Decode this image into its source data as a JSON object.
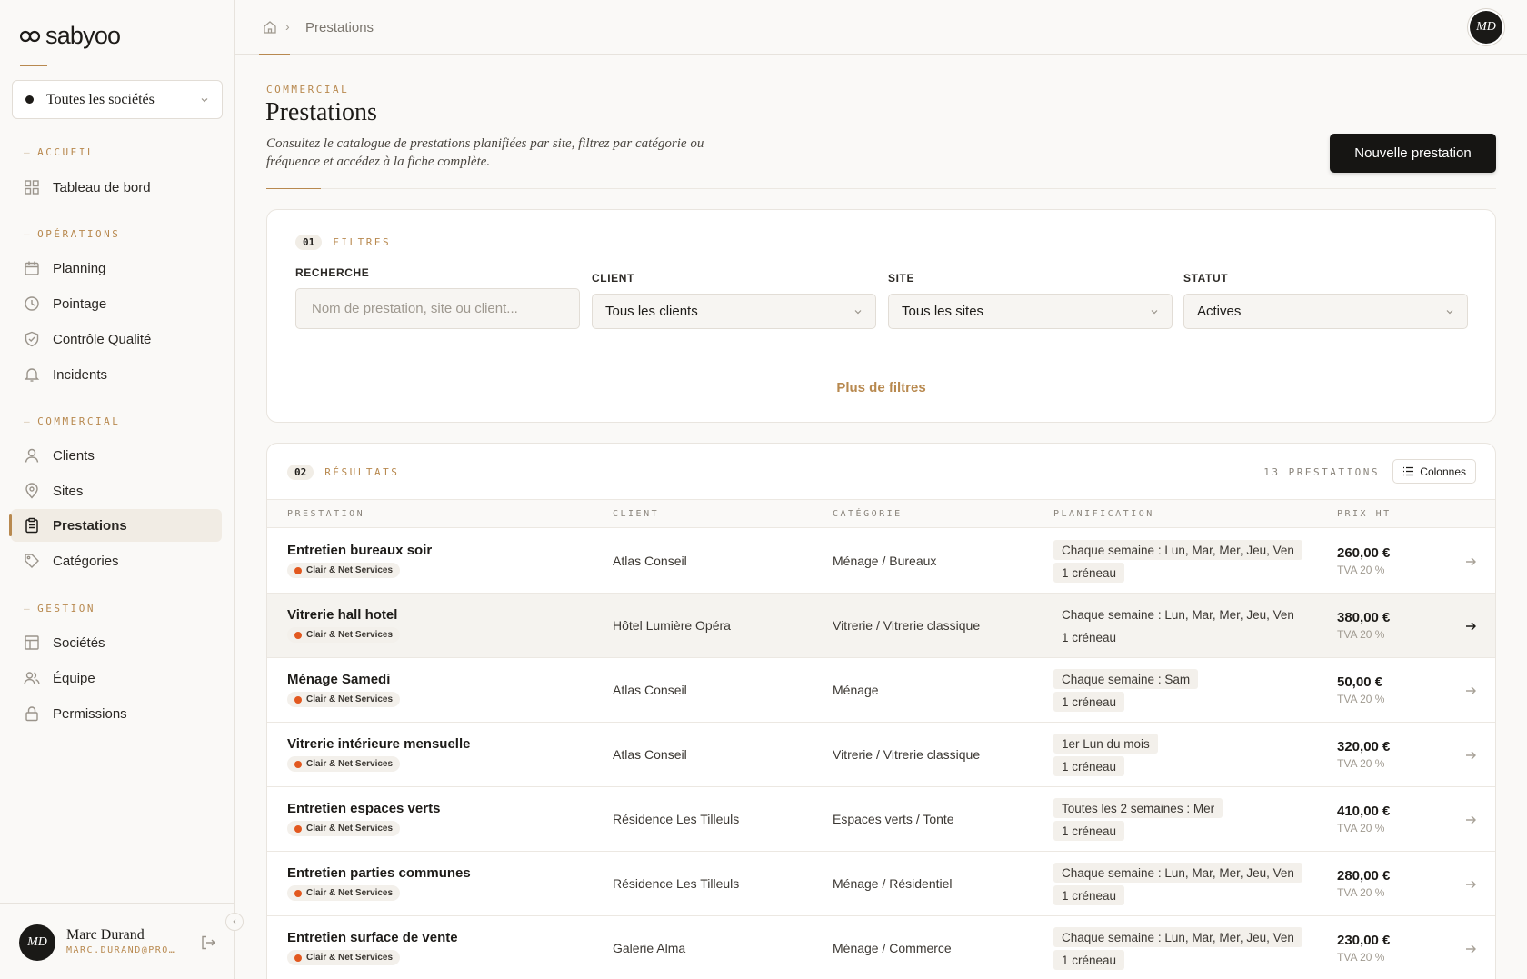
{
  "brand": {
    "name": "sabyoo"
  },
  "company_selector": {
    "label": "Toutes les sociétés"
  },
  "nav": {
    "sections": [
      {
        "label": "ACCUEIL",
        "items": [
          {
            "label": "Tableau de bord",
            "icon": "dashboard-icon"
          }
        ]
      },
      {
        "label": "OPÉRATIONS",
        "items": [
          {
            "label": "Planning",
            "icon": "calendar-icon"
          },
          {
            "label": "Pointage",
            "icon": "clock-icon"
          },
          {
            "label": "Contrôle Qualité",
            "icon": "shield-check-icon"
          },
          {
            "label": "Incidents",
            "icon": "bell-icon"
          }
        ]
      },
      {
        "label": "COMMERCIAL",
        "items": [
          {
            "label": "Clients",
            "icon": "user-icon"
          },
          {
            "label": "Sites",
            "icon": "map-pin-icon"
          },
          {
            "label": "Prestations",
            "icon": "clipboard-icon",
            "active": true
          },
          {
            "label": "Catégories",
            "icon": "tag-icon"
          }
        ]
      },
      {
        "label": "GESTION",
        "items": [
          {
            "label": "Sociétés",
            "icon": "building-icon"
          },
          {
            "label": "Équipe",
            "icon": "users-icon"
          },
          {
            "label": "Permissions",
            "icon": "lock-icon"
          }
        ]
      }
    ]
  },
  "user": {
    "initials": "MD",
    "name": "Marc Durand",
    "email": "MARC.DURAND@PRO…"
  },
  "breadcrumb": {
    "current": "Prestations"
  },
  "header": {
    "eyebrow": "COMMERCIAL",
    "title": "Prestations",
    "description": "Consultez le catalogue de prestations planifiées par site, filtrez par catégorie ou fréquence et accédez à la fiche complète.",
    "primary_action": "Nouvelle prestation"
  },
  "filters": {
    "step": "01",
    "title": "FILTRES",
    "search": {
      "label": "RECHERCHE",
      "placeholder": "Nom de prestation, site ou client..."
    },
    "client": {
      "label": "CLIENT",
      "value": "Tous les clients"
    },
    "site": {
      "label": "SITE",
      "value": "Tous les sites"
    },
    "status": {
      "label": "STATUT",
      "value": "Actives"
    },
    "more": "Plus de filtres"
  },
  "results": {
    "step": "02",
    "title": "RÉSULTATS",
    "count": "13 PRESTATIONS",
    "columns_button": "Colonnes",
    "headers": [
      "PRESTATION",
      "CLIENT",
      "CATÉGORIE",
      "PLANIFICATION",
      "PRIX HT"
    ],
    "rows": [
      {
        "name": "Entretien bureaux soir",
        "company": "Clair & Net Services",
        "client": "Atlas Conseil",
        "category": "Ménage / Bureaux",
        "schedule": "Chaque semaine : Lun, Mar, Mer, Jeu, Ven",
        "slots": "1 créneau",
        "price": "260,00 €",
        "vat": "TVA 20 %"
      },
      {
        "name": "Vitrerie hall hotel",
        "company": "Clair & Net Services",
        "client": "Hôtel Lumière Opéra",
        "category": "Vitrerie / Vitrerie classique",
        "schedule": "Chaque semaine : Lun, Mar, Mer, Jeu, Ven",
        "slots": "1 créneau",
        "price": "380,00 €",
        "vat": "TVA 20 %",
        "hover": true
      },
      {
        "name": "Ménage Samedi",
        "company": "Clair & Net Services",
        "client": "Atlas Conseil",
        "category": "Ménage",
        "schedule": "Chaque semaine : Sam",
        "slots": "1 créneau",
        "price": "50,00 €",
        "vat": "TVA 20 %"
      },
      {
        "name": "Vitrerie intérieure mensuelle",
        "company": "Clair & Net Services",
        "client": "Atlas Conseil",
        "category": "Vitrerie / Vitrerie classique",
        "schedule": "1er Lun du mois",
        "slots": "1 créneau",
        "price": "320,00 €",
        "vat": "TVA 20 %"
      },
      {
        "name": "Entretien espaces verts",
        "company": "Clair & Net Services",
        "client": "Résidence Les Tilleuls",
        "category": "Espaces verts / Tonte",
        "schedule": "Toutes les 2 semaines : Mer",
        "slots": "1 créneau",
        "price": "410,00 €",
        "vat": "TVA 20 %"
      },
      {
        "name": "Entretien parties communes",
        "company": "Clair & Net Services",
        "client": "Résidence Les Tilleuls",
        "category": "Ménage / Résidentiel",
        "schedule": "Chaque semaine : Lun, Mar, Mer, Jeu, Ven",
        "slots": "1 créneau",
        "price": "280,00 €",
        "vat": "TVA 20 %"
      },
      {
        "name": "Entretien surface de vente",
        "company": "Clair & Net Services",
        "client": "Galerie Alma",
        "category": "Ménage / Commerce",
        "schedule": "Chaque semaine : Lun, Mar, Mer, Jeu, Ven",
        "slots": "1 créneau",
        "price": "230,00 €",
        "vat": "TVA 20 %"
      }
    ]
  },
  "colors": {
    "accent": "#b8894f",
    "primary": "#161513",
    "tag_dot": "#e2581f"
  }
}
